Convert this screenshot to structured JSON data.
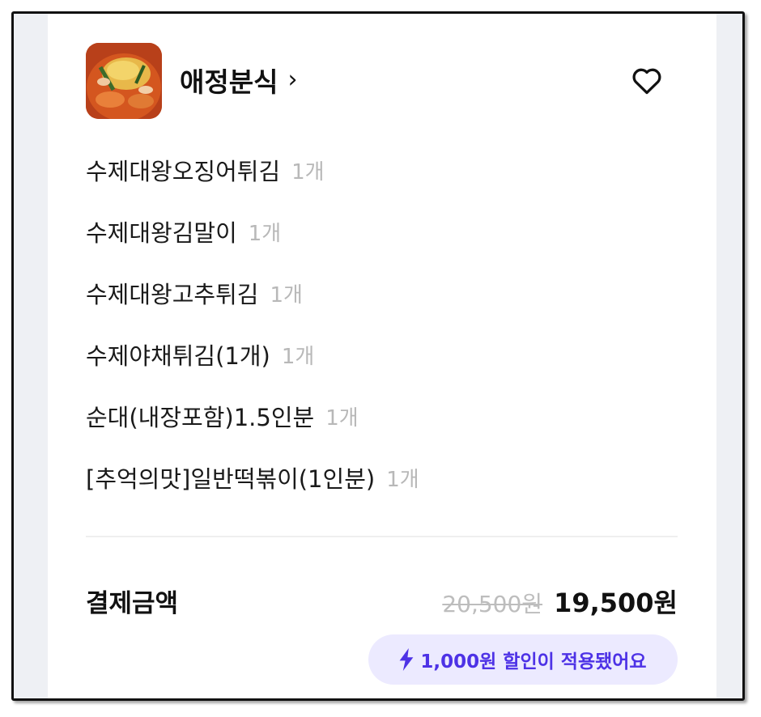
{
  "store": {
    "name": "애정분식",
    "chevron": "›"
  },
  "order_items": [
    {
      "name": "수제대왕오징어튀김",
      "qty": "1개"
    },
    {
      "name": "수제대왕김말이",
      "qty": "1개"
    },
    {
      "name": "수제대왕고추튀김",
      "qty": "1개"
    },
    {
      "name": "수제야채튀김(1개)",
      "qty": "1개"
    },
    {
      "name": "순대(내장포함)1.5인분",
      "qty": "1개"
    },
    {
      "name": "[추억의맛]일반떡볶이(1인분)",
      "qty": "1개"
    }
  ],
  "payment": {
    "label": "결제금액",
    "original_price": "20,500원",
    "final_price": "19,500원",
    "discount_text": "1,000원 할인이 적용됐어요"
  },
  "colors": {
    "accent": "#4d32e6",
    "discount_bg": "#eceaff",
    "muted": "#b8b8b8"
  },
  "icons": {
    "favorite": "heart-outline-icon",
    "discount": "lightning-bolt-icon",
    "store_link": "chevron-right-icon"
  }
}
